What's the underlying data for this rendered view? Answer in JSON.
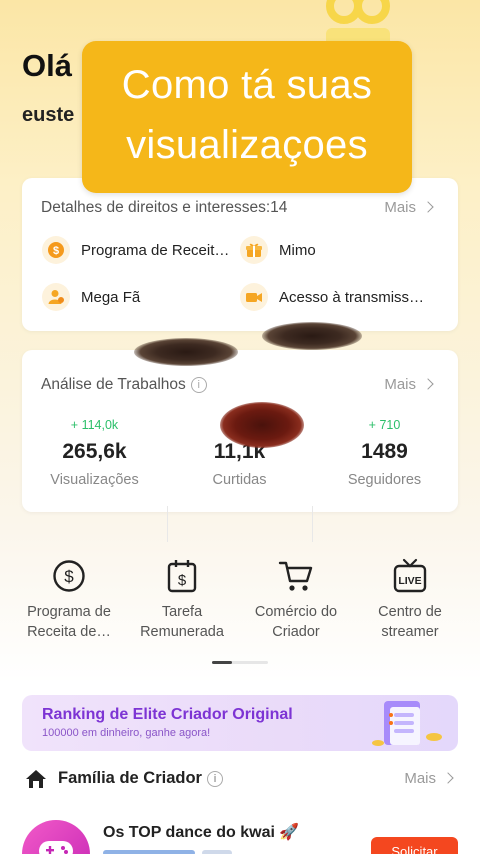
{
  "header": {
    "greeting": "Olá",
    "username": "euste"
  },
  "overlay_caption": {
    "line1": "Como tá suas",
    "line2": "visualizaçoes"
  },
  "rights_card": {
    "title": "Detalhes de direitos e interesses:14",
    "more": "Mais",
    "items": [
      {
        "label": "Programa de Receit…",
        "icon": "dollar-coin-icon"
      },
      {
        "label": "Mimo",
        "icon": "gift-icon"
      },
      {
        "label": "Mega Fã",
        "icon": "fan-user-icon"
      },
      {
        "label": "Acesso à transmiss…",
        "icon": "video-camera-icon"
      }
    ]
  },
  "works_card": {
    "title": "Análise de Trabalhos",
    "more": "Mais",
    "stats": [
      {
        "delta": "+ 114,0k",
        "value": "265,6k",
        "label": "Visualizações"
      },
      {
        "delta": "",
        "value": "11,1k",
        "label": "Curtidas"
      },
      {
        "delta": "+ 710",
        "value": "1489",
        "label": "Seguidores"
      }
    ]
  },
  "tools": [
    {
      "line1": "Programa de",
      "line2": "Receita de…",
      "icon": "dollar-circle-icon"
    },
    {
      "line1": "Tarefa",
      "line2": "Remunerada",
      "icon": "calendar-dollar-icon"
    },
    {
      "line1": "Comércio do",
      "line2": "Criador",
      "icon": "shopping-cart-icon"
    },
    {
      "line1": "Centro de",
      "line2": "streamer",
      "icon": "live-tv-icon"
    }
  ],
  "banner": {
    "title": "Ranking de Elite Criador Original",
    "subtitle": "100000 em dinheiro, ganhe agora!"
  },
  "family": {
    "title": "Família de Criador",
    "more": "Mais"
  },
  "family_item": {
    "title": "Os TOP dance do kwai 🚀",
    "button": "Solicitar"
  },
  "colors": {
    "accent": "#f5b719",
    "positive": "#2cbf6a",
    "banner_text": "#7d34d4",
    "cta": "#f4471f"
  }
}
